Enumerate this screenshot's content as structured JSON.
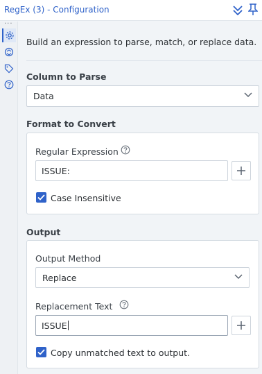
{
  "window": {
    "title": "RegEx (3) - Configuration"
  },
  "icons": {
    "collapse": "chevron-down-icon",
    "pin": "pin-icon",
    "rail": [
      "settings-icon",
      "convert-icon",
      "tag-icon",
      "help-icon"
    ]
  },
  "colors": {
    "accent": "#2f62c9",
    "background": "#f1f4f7"
  },
  "intro": "Build an expression to parse, match, or replace data.",
  "column_to_parse": {
    "label": "Column to Parse",
    "value": "Data"
  },
  "format": {
    "label": "Format to Convert",
    "regex_label": "Regular Expression",
    "regex_value": "ISSUE:",
    "case_insensitive_label": "Case Insensitive",
    "case_insensitive_checked": true
  },
  "output": {
    "label": "Output",
    "method_label": "Output Method",
    "method_value": "Replace",
    "replacement_label": "Replacement Text",
    "replacement_value": "ISSUE",
    "copy_unmatched_label": "Copy unmatched text to output.",
    "copy_unmatched_checked": true
  }
}
